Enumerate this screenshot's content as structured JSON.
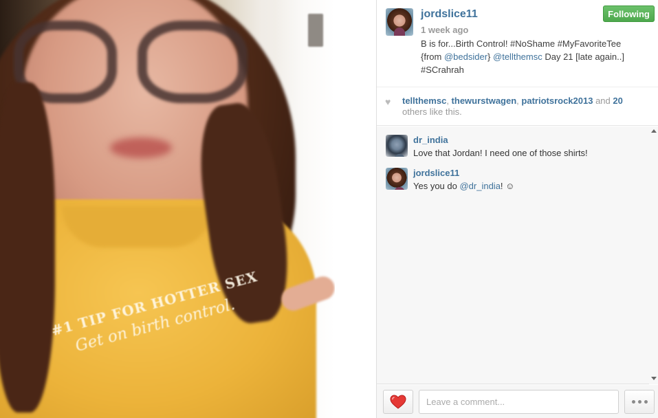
{
  "post": {
    "username": "jordslice11",
    "time_ago": "1 week ago",
    "follow_label": "Following",
    "caption": {
      "part1": "B is for...Birth Control! #NoShame #MyFavoriteTee {from ",
      "mention1": "@bedsider",
      "part2": "} ",
      "mention2": "@tellthemsc",
      "part3": " Day 21 [late again..] #SCrahrah"
    },
    "image_text": {
      "line1": "#1 TIP FOR HOTTER SEX",
      "line2": "Get on birth control."
    }
  },
  "likes": {
    "user1": "tellthemsc",
    "sep1": ", ",
    "user2": "thewurstwagen",
    "sep2": ", ",
    "user3": "patriotsrock2013",
    "and": " and ",
    "others_count": "20",
    "others_text": " others like this."
  },
  "comments": [
    {
      "username": "dr_india",
      "text": "Love that Jordan! I need one of those shirts!"
    },
    {
      "username": "jordslice11",
      "text_before": "Yes you do ",
      "mention": "@dr_india",
      "text_after": "! ☺"
    }
  ],
  "footer": {
    "comment_placeholder": "Leave a comment...",
    "like_icon": "heart-icon",
    "more_icon": "ellipsis-icon"
  },
  "colors": {
    "link": "#3f729b",
    "follow_green": "#5cb85c",
    "heart_red": "#e53935"
  }
}
